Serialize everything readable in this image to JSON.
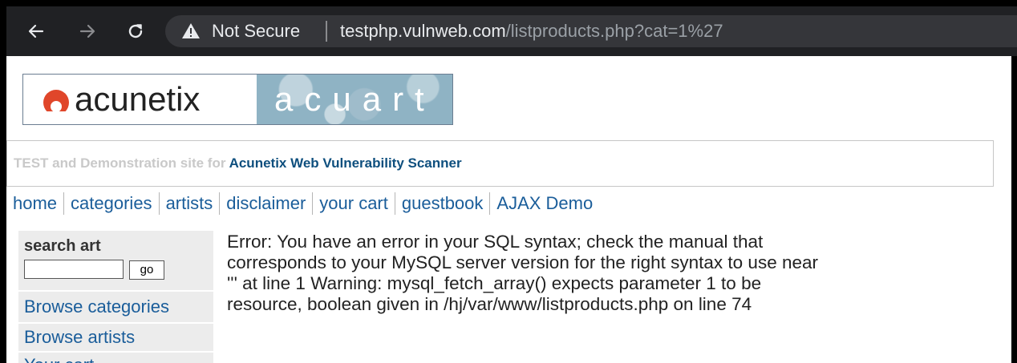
{
  "browser": {
    "back_icon": "arrow-left-icon",
    "forward_icon": "arrow-right-icon",
    "reload_icon": "reload-icon",
    "security_icon": "warning-triangle-icon",
    "security_label": "Not Secure",
    "url_host": "testphp.vulnweb.com",
    "url_path": "/listproducts.php?cat=1%27"
  },
  "logo": {
    "brand": "acunetix",
    "product": "acuart"
  },
  "tagline": {
    "prefix": "TEST and Demonstration site for ",
    "emphasis": "Acunetix Web Vulnerability Scanner"
  },
  "menu": {
    "items": [
      "home",
      "categories",
      "artists",
      "disclaimer",
      "your cart",
      "guestbook",
      "AJAX Demo"
    ]
  },
  "sidebar": {
    "search_title": "search art",
    "search_value": "",
    "go_label": "go",
    "links": [
      "Browse categories",
      "Browse artists",
      "Your cart"
    ]
  },
  "main": {
    "error_lines": [
      "Error: You have an error in your SQL syntax; check the manual that",
      "corresponds to your MySQL server version for the right syntax to use near",
      "''' at line 1 Warning: mysql_fetch_array() expects parameter 1 to be",
      "resource, boolean given in /hj/var/www/listproducts.php on line 74"
    ]
  },
  "colors": {
    "chrome_bg": "#202124",
    "omnibox_bg": "#35363a",
    "link": "#1a5d9a",
    "tagline_emphasis": "#0e4f7e",
    "logo_accent": "#e0462a"
  }
}
